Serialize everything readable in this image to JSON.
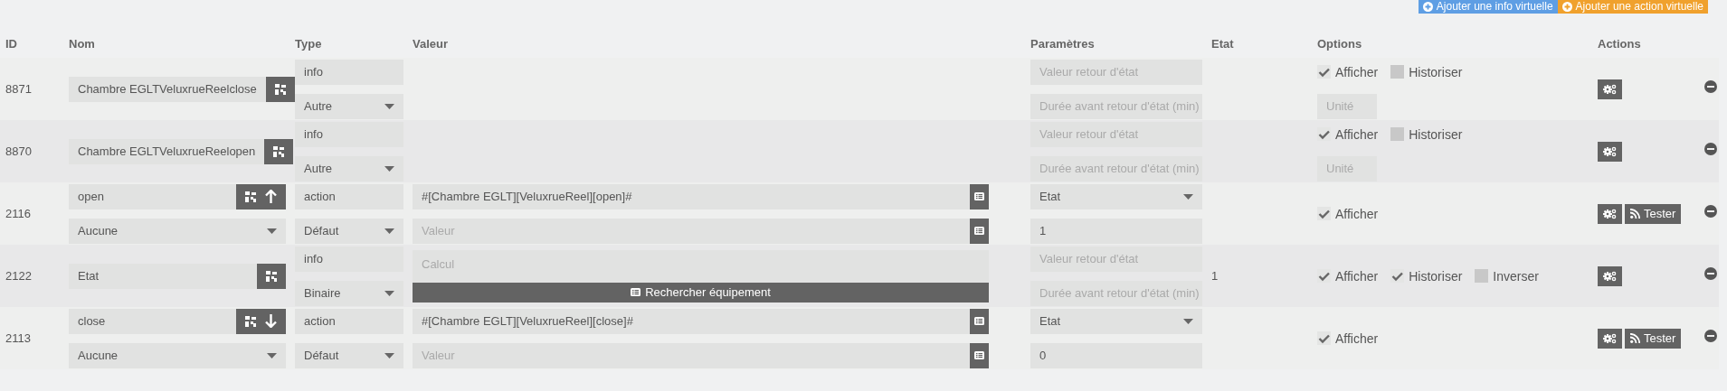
{
  "toolbar": {
    "buttons": [
      {
        "label": "Ajouter une info virtuelle",
        "kind": "info"
      },
      {
        "label": "Ajouter une action virtuelle",
        "kind": "action"
      }
    ]
  },
  "table": {
    "columns": [
      "ID",
      "Nom",
      "Type",
      "Valeur",
      "Paramètres",
      "Etat",
      "Options",
      "Actions"
    ],
    "rows": [
      {
        "id": "8871",
        "name": {
          "value": "Chambre EGLTVeluxrueReelclose"
        },
        "type": "info",
        "subtype": "Autre",
        "params": [
          {
            "kind": "input",
            "placeholder": "Valeur retour d'état"
          },
          {
            "kind": "input",
            "placeholder": "Durée avant retour d'état (min)"
          }
        ],
        "options": [
          {
            "label": "Afficher",
            "checked": true
          },
          {
            "label": "Historiser",
            "checked": false
          }
        ],
        "unit": {
          "placeholder": "Unité"
        },
        "actions": [
          {
            "kind": "configure"
          }
        ]
      },
      {
        "id": "8870",
        "name": {
          "value": "Chambre EGLTVeluxrueReelopen"
        },
        "type": "info",
        "subtype": "Autre",
        "params": [
          {
            "kind": "input",
            "placeholder": "Valeur retour d'état"
          },
          {
            "kind": "input",
            "placeholder": "Durée avant retour d'état (min)"
          }
        ],
        "options": [
          {
            "label": "Afficher",
            "checked": true
          },
          {
            "label": "Historiser",
            "checked": false
          }
        ],
        "unit": {
          "placeholder": "Unité"
        },
        "actions": [
          {
            "kind": "configure"
          }
        ]
      },
      {
        "id": "2116",
        "name": {
          "value": "open",
          "kind": "up"
        },
        "name_select": "Aucune",
        "type": "action",
        "subtype": "Défaut",
        "value": {
          "kind": "command",
          "fields": [
            {
              "value": "#[Chambre EGLT][VeluxrueReel][open]#"
            },
            {
              "placeholder": "Valeur"
            }
          ]
        },
        "params": [
          {
            "kind": "select",
            "value": "Etat"
          },
          {
            "kind": "input",
            "value": "1"
          }
        ],
        "options": [
          {
            "label": "Afficher",
            "checked": true
          }
        ],
        "actions": [
          {
            "kind": "configure"
          },
          {
            "kind": "test",
            "label": "Tester"
          }
        ]
      },
      {
        "id": "2122",
        "name": {
          "value": "Etat"
        },
        "type": "info",
        "subtype": "Binaire",
        "value": {
          "kind": "calcul",
          "placeholder": "Calcul",
          "button": "Rechercher équipement"
        },
        "params": [
          {
            "kind": "input",
            "placeholder": "Valeur retour d'état"
          },
          {
            "kind": "input",
            "placeholder": "Durée avant retour d'état (min)"
          }
        ],
        "state": "1",
        "options": [
          {
            "label": "Afficher",
            "checked": true
          },
          {
            "label": "Historiser",
            "checked": true
          },
          {
            "label": "Inverser",
            "checked": false
          }
        ],
        "actions": [
          {
            "kind": "configure"
          }
        ]
      },
      {
        "id": "2113",
        "name": {
          "value": "close",
          "kind": "down"
        },
        "name_select": "Aucune",
        "type": "action",
        "subtype": "Défaut",
        "value": {
          "kind": "command",
          "fields": [
            {
              "value": "#[Chambre EGLT][VeluxrueReel][close]#"
            },
            {
              "placeholder": "Valeur"
            }
          ]
        },
        "params": [
          {
            "kind": "select",
            "value": "Etat"
          },
          {
            "kind": "input",
            "value": "0"
          }
        ],
        "options": [
          {
            "label": "Afficher",
            "checked": true
          }
        ],
        "actions": [
          {
            "kind": "configure"
          },
          {
            "kind": "test",
            "label": "Tester"
          }
        ]
      }
    ]
  }
}
